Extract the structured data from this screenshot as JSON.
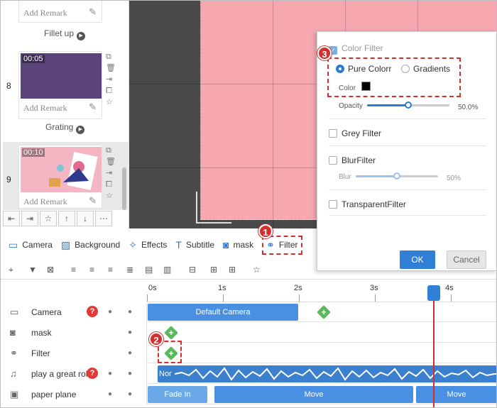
{
  "scenes": [
    {
      "remark": "Add Remark",
      "animation": "Fillet up"
    },
    {
      "number": "8",
      "time": "00:05",
      "remark": "Add Remark",
      "animation": "Grating"
    },
    {
      "number": "9",
      "time": "00:10",
      "remark": "Add Remark"
    }
  ],
  "filter_panel": {
    "title": "Color Filter",
    "pure_color": "Pure Colorr",
    "gradients": "Gradients",
    "color_label": "Color",
    "opacity_label": "Opacity",
    "opacity_value": "50.0%",
    "opacity_level": 0.5,
    "grey": "Grey Filter",
    "blur": "BlurFilter",
    "blur_label": "Blur",
    "blur_value": "50%",
    "blur_level": 0.5,
    "transparent": "TransparentFilter",
    "ok": "OK",
    "cancel": "Cancel"
  },
  "badges": {
    "one": "1",
    "two": "2",
    "three": "3"
  },
  "tabs": [
    "Camera",
    "Background",
    "Effects",
    "Subtitle",
    "mask",
    "Filter"
  ],
  "ruler": [
    "0s",
    "1s",
    "2s",
    "3s",
    "4s"
  ],
  "tracks": [
    {
      "name": "Camera",
      "clip": "Default Camera"
    },
    {
      "name": "mask"
    },
    {
      "name": "Filter"
    },
    {
      "name": "play a great rol",
      "clip": "Nor"
    },
    {
      "name": "paper plane",
      "clip1": "Fade In",
      "clip2": "Move",
      "clip3": "Move"
    }
  ],
  "help": "?",
  "colors": {
    "accent": "#2b7bd6",
    "pink": "#f6a7b0",
    "scene8": "#5a4479",
    "red": "#d32f2f"
  }
}
